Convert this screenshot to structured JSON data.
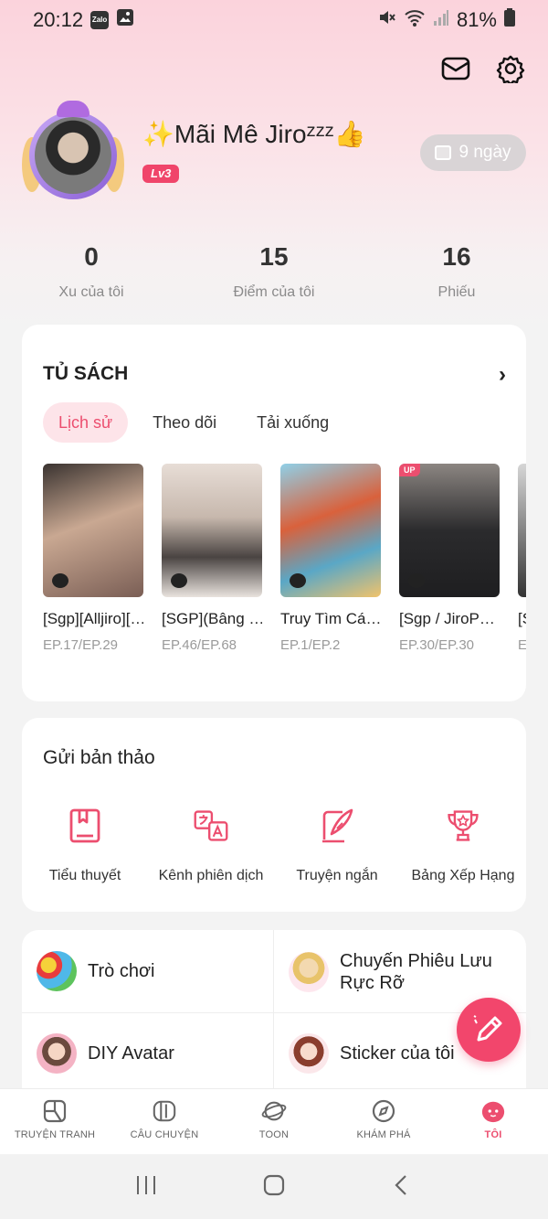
{
  "status_bar": {
    "time": "20:12",
    "battery": "81%",
    "zalo_label": "Zalo"
  },
  "profile": {
    "name": "✨Mãi Mê Jiroᶻᶻᶻ👍",
    "level": "Lv3",
    "days": "9 ngày"
  },
  "stats": [
    {
      "value": "0",
      "label": "Xu của tôi"
    },
    {
      "value": "15",
      "label": "Điểm của tôi"
    },
    {
      "value": "16",
      "label": "Phiếu"
    }
  ],
  "bookshelf": {
    "title": "TỦ SÁCH",
    "tabs": [
      "Lịch sử",
      "Theo dõi",
      "Tải xuống"
    ],
    "books": [
      {
        "title": "[Sgp][Alljiro][…",
        "episode": "EP.17/EP.29",
        "badge": ""
      },
      {
        "title": "[SGP](Bâng …",
        "episode": "EP.46/EP.68",
        "badge": ""
      },
      {
        "title": "Truy Tìm Cá…",
        "episode": "EP.1/EP.2",
        "badge": ""
      },
      {
        "title": "[Sgp / JiroP…",
        "episode": "EP.30/EP.30",
        "badge": "UP"
      },
      {
        "title": "[S",
        "episode": "E",
        "badge": ""
      }
    ]
  },
  "submit": {
    "title": "Gửi bản thảo",
    "items": [
      "Tiểu thuyết",
      "Kênh phiên dịch",
      "Truyện ngắn",
      "Bảng Xếp Hạng"
    ]
  },
  "grid": {
    "games": "Trò chơi",
    "adventure_line1": "Chuyến Phiêu Lưu",
    "adventure_line2": "Rực Rỡ",
    "diy_avatar": "DIY Avatar",
    "stickers": "Sticker của tôi"
  },
  "bottom_nav": [
    "TRUYỆN TRANH",
    "CÂU CHUYỆN",
    "TOON",
    "KHÁM PHÁ",
    "TÔI"
  ],
  "colors": {
    "accent": "#ec4e6f",
    "fab": "#f2466c",
    "level": "#f0456a"
  }
}
